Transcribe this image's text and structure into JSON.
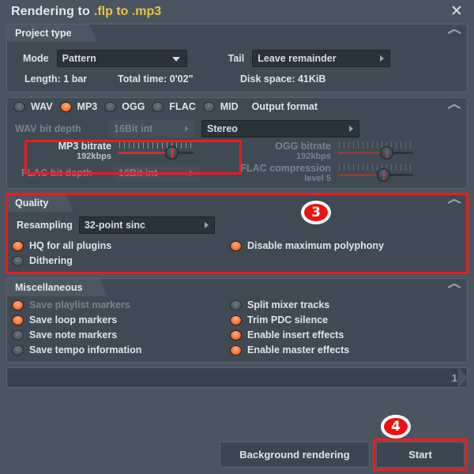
{
  "window": {
    "title_prefix": "Rendering to",
    "title_file": ".flp to .mp3",
    "close_icon": "close-icon"
  },
  "project_type": {
    "header": "Project type",
    "mode_label": "Mode",
    "mode_value": "Pattern",
    "tail_label": "Tail",
    "tail_value": "Leave remainder",
    "length": "Length: 1 bar",
    "total_time": "Total time: 0'02\"",
    "disk_space": "Disk space: 41KiB"
  },
  "output_format": {
    "header": "Output format",
    "formats": [
      {
        "label": "WAV",
        "selected": false
      },
      {
        "label": "MP3",
        "selected": true
      },
      {
        "label": "OGG",
        "selected": false
      },
      {
        "label": "FLAC",
        "selected": false
      },
      {
        "label": "MID",
        "selected": false
      }
    ],
    "wav_bit_depth_label": "WAV bit depth",
    "wav_bit_depth_value": "16Bit int",
    "channels_value": "Stereo",
    "mp3_bitrate_label": "MP3 bitrate",
    "mp3_bitrate_value": "192kbps",
    "ogg_bitrate_label": "OGG bitrate",
    "ogg_bitrate_value": "192kbps",
    "flac_bit_depth_label": "FLAC bit depth",
    "flac_bit_depth_value": "16Bit int",
    "flac_compression_label": "FLAC compression",
    "flac_compression_value": "level 5"
  },
  "quality": {
    "header": "Quality",
    "resampling_label": "Resampling",
    "resampling_value": "32-point sinc",
    "options": [
      {
        "label": "HQ for all plugins",
        "on": true
      },
      {
        "label": "Disable maximum polyphony",
        "on": true
      },
      {
        "label": "Dithering",
        "on": false
      }
    ]
  },
  "miscellaneous": {
    "header": "Miscellaneous",
    "left": [
      {
        "label": "Save playlist markers",
        "on": true,
        "dim": true
      },
      {
        "label": "Save loop markers",
        "on": true,
        "dim": false
      },
      {
        "label": "Save note markers",
        "on": false,
        "dim": false
      },
      {
        "label": "Save tempo information",
        "on": false,
        "dim": false
      }
    ],
    "right": [
      {
        "label": "Split mixer tracks",
        "on": false,
        "dim": false
      },
      {
        "label": "Trim PDC silence",
        "on": true,
        "dim": false
      },
      {
        "label": "Enable insert effects",
        "on": true,
        "dim": false
      },
      {
        "label": "Enable master effects",
        "on": true,
        "dim": false
      }
    ]
  },
  "footer": {
    "progress_value": "1",
    "background_rendering_label": "Background rendering",
    "start_label": "Start"
  },
  "annotations": {
    "badge_3": "3",
    "badge_4": "4"
  },
  "colors": {
    "accent_orange": "#f4753d",
    "highlight_red": "#ee1c1c",
    "title_gold": "#f0c244",
    "panel_bg": "#3f4a55",
    "window_bg": "#4a5561"
  }
}
